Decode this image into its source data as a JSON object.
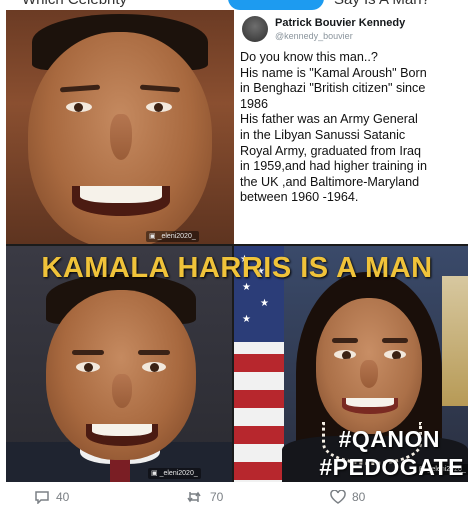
{
  "top_strip": {
    "left_text": "Which Celebrity",
    "right_text": "Say Is A Man?"
  },
  "meme": {
    "headline": "KAMALA HARRIS IS A MAN",
    "hashtags": [
      "#QANON",
      "#PEDOGATE"
    ],
    "watermark": "_eleni2020_"
  },
  "tweet": {
    "name": "Patrick Bouvier Kennedy",
    "handle": "@kennedy_bouvier",
    "lines": [
      "Do you know this man..?",
      "His name is \"Kamal Aroush\" Born",
      "in Benghazi \"British citizen\" since",
      "1986",
      "His father was an Army General",
      "in the Libyan Sanussi Satanic",
      "Royal Army, graduated from Iraq",
      "in 1959,and had higher training in",
      "the UK ,and Baltimore-Maryland",
      "between 1960 -1964."
    ]
  },
  "actions": {
    "comments": "40",
    "retweets": "70",
    "likes": "80"
  },
  "icons": {
    "comment": "comment-icon",
    "retweet": "retweet-icon",
    "like": "heart-icon",
    "instagram": "instagram-icon"
  },
  "colors": {
    "headline": "#f0c33a",
    "hashtag": "#ffffff",
    "action_gray": "#7b8085"
  }
}
